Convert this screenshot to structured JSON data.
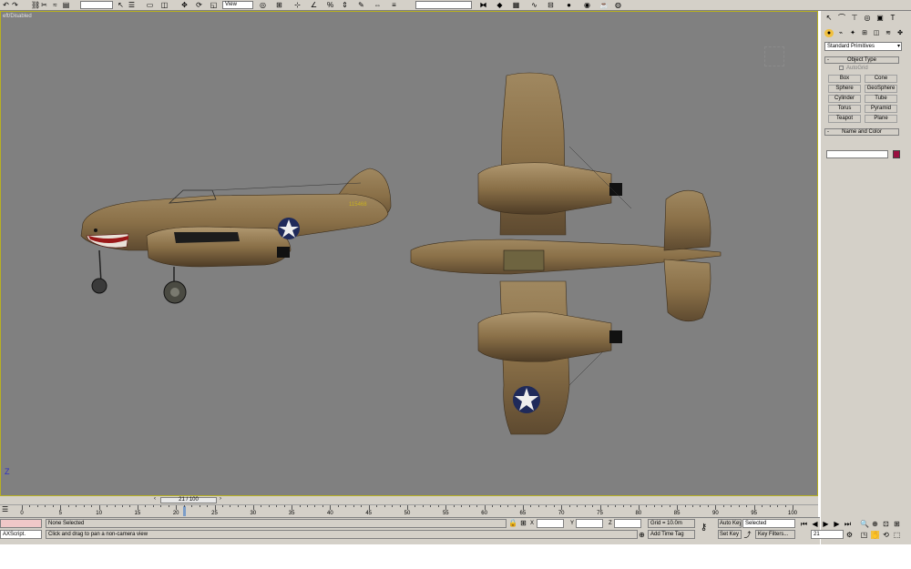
{
  "toolbar": {
    "icons": [
      "undo-icon",
      "redo-icon",
      "select-link-icon",
      "unlink-icon",
      "bind-spacewarp-icon",
      "selection-filter-icon",
      "select-object-icon",
      "select-by-name-icon",
      "rectangle-selection-icon",
      "window-crossing-icon",
      "select-move-icon",
      "select-rotate-icon",
      "select-scale-icon",
      "reference-coord-icon",
      "pivot-icon",
      "select-manipulate-icon",
      "snap-icon",
      "angle-snap-icon",
      "percent-snap-icon",
      "spinner-snap-icon",
      "named-selection-icon",
      "mirror-icon",
      "align-icon",
      "layer-manager-icon",
      "curve-editor-icon",
      "schematic-view-icon",
      "material-editor-icon",
      "render-scene-icon",
      "quick-render-icon",
      "render-type-icon"
    ],
    "coord_system": "View"
  },
  "viewport": {
    "label": "eft/Disabled",
    "axis": "Z",
    "colors": {
      "background": "#808080",
      "border": "#b8b020",
      "aircraft": "#8a7048"
    }
  },
  "command_panel": {
    "tabs": [
      "create-tab-icon",
      "modify-tab-icon",
      "hierarchy-tab-icon",
      "motion-tab-icon",
      "display-tab-icon",
      "utilities-tab-icon"
    ],
    "categories": [
      "geometry-icon",
      "shapes-icon",
      "lights-icon",
      "cameras-icon",
      "helpers-icon",
      "space-warps-icon",
      "systems-icon"
    ],
    "dropdown_value": "Standard Primitives",
    "object_type": {
      "title": "Object Type",
      "autogrid": "AutoGrid",
      "buttons": [
        "Box",
        "Cone",
        "Sphere",
        "GeoSphere",
        "Cylinder",
        "Tube",
        "Torus",
        "Pyramid",
        "Teapot",
        "Plane"
      ]
    },
    "name_color": {
      "title": "Name and Color",
      "name": "",
      "color": "#9a1040"
    }
  },
  "timeline": {
    "frame_display": "21 / 100",
    "current_frame": 21,
    "total_frames": 100,
    "ruler_labels": [
      "0",
      "5",
      "10",
      "15",
      "20",
      "25",
      "30",
      "35",
      "40",
      "45",
      "50",
      "55",
      "60",
      "65",
      "70",
      "75",
      "80",
      "85",
      "90",
      "95",
      "100"
    ]
  },
  "status": {
    "maxscript_label": "AXScript.",
    "selection": "None Selected",
    "prompt": "Click and drag to pan a non-camera view",
    "x_label": "X",
    "y_label": "Y",
    "z_label": "Z",
    "grid": "Grid = 10.0m",
    "add_time_tag": "Add Time Tag",
    "auto_key": "Auto Key",
    "set_key": "Set Key",
    "key_mode_select": "Selected",
    "key_filters": "Key Filters...",
    "frame_spinner": "21"
  }
}
